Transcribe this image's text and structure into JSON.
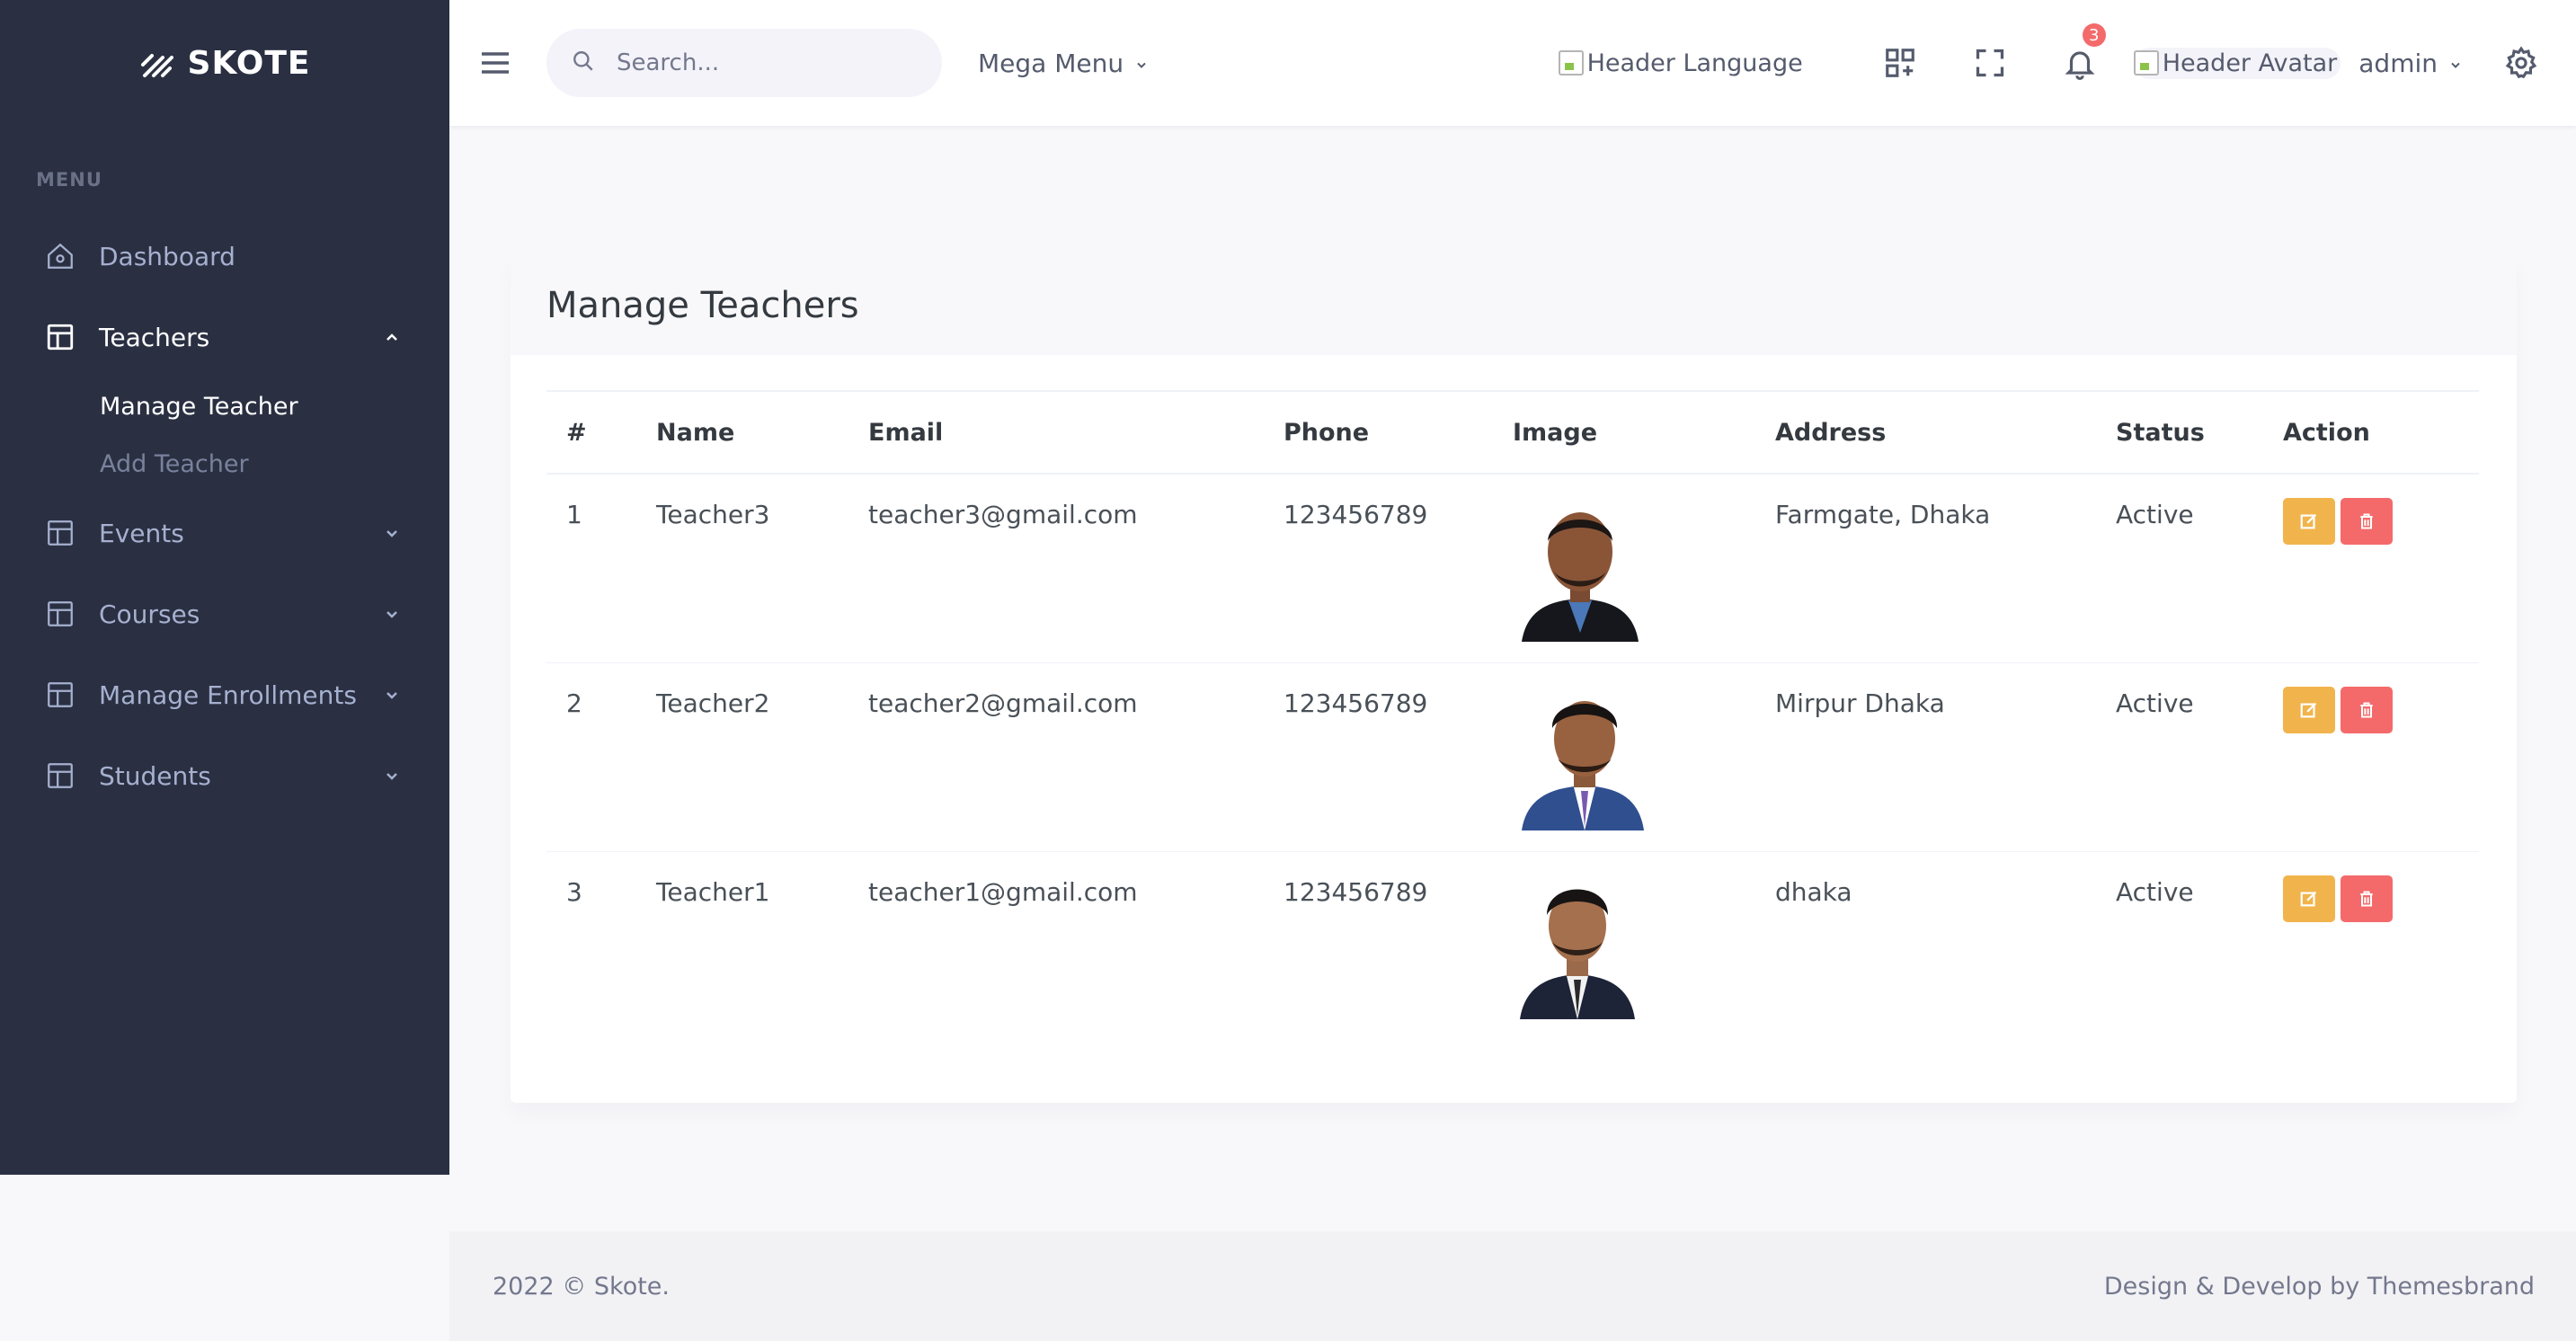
{
  "brand": {
    "name": "SKOTE"
  },
  "sidebar": {
    "menu_title": "MENU",
    "items": [
      {
        "label": "Dashboard",
        "icon": "home-icon"
      },
      {
        "label": "Teachers",
        "icon": "layout-icon"
      },
      {
        "label": "Events",
        "icon": "layout-icon"
      },
      {
        "label": "Courses",
        "icon": "layout-icon"
      },
      {
        "label": "Manage Enrollments",
        "icon": "layout-icon"
      },
      {
        "label": "Students",
        "icon": "layout-icon"
      }
    ],
    "teachers_sub": [
      {
        "label": "Manage Teacher"
      },
      {
        "label": "Add Teacher"
      }
    ]
  },
  "header": {
    "search_placeholder": "Search...",
    "mega_menu": "Mega Menu",
    "language_alt": "Header Language",
    "notification_count": "3",
    "avatar_alt": "Header Avatar",
    "username": "admin"
  },
  "card": {
    "title": "Manage Teachers",
    "columns": [
      "#",
      "Name",
      "Email",
      "Phone",
      "Image",
      "Address",
      "Status",
      "Action"
    ],
    "rows": [
      {
        "num": "1",
        "name": "Teacher3",
        "email": "teacher3@gmail.com",
        "phone": "123456789",
        "address": "Farmgate, Dhaka",
        "status": "Active"
      },
      {
        "num": "2",
        "name": "Teacher2",
        "email": "teacher2@gmail.com",
        "phone": "123456789",
        "address": "Mirpur Dhaka",
        "status": "Active"
      },
      {
        "num": "3",
        "name": "Teacher1",
        "email": "teacher1@gmail.com",
        "phone": "123456789",
        "address": "dhaka",
        "status": "Active"
      }
    ]
  },
  "footer": {
    "copyright": "2022 © Skote.",
    "credit": "Design & Develop by Themesbrand"
  },
  "colors": {
    "sidebar_bg": "#2a3042",
    "edit_button": "#f1b44c",
    "delete_button": "#f46a6a",
    "badge": "#f46a6a"
  }
}
